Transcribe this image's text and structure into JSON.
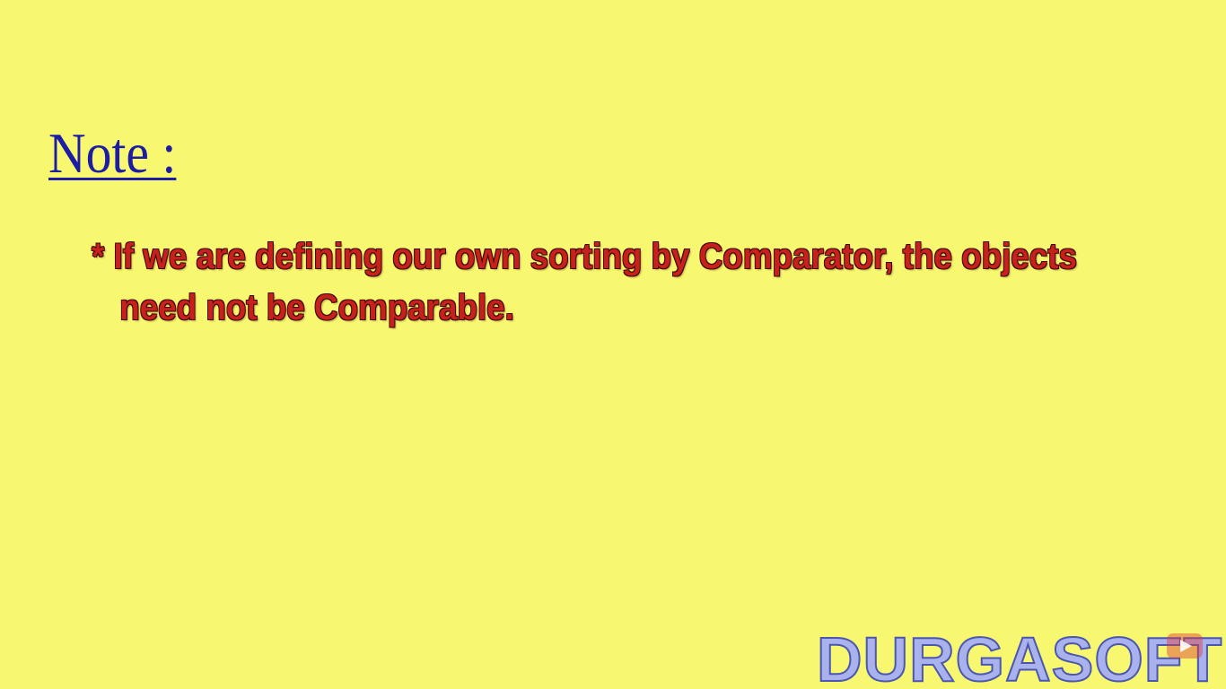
{
  "note": {
    "heading": "Note :"
  },
  "bullet": {
    "line1": "* If we are defining our own sorting by Comparator, the objects",
    "line2": "need not be Comparable."
  },
  "branding": {
    "logo_text": "DURGASOFT",
    "icon": "youtube-play-icon"
  },
  "colors": {
    "background": "#f8f870",
    "heading": "#1c1ca4",
    "bullet_text": "#c8201c",
    "logo": "#aab2ee"
  }
}
